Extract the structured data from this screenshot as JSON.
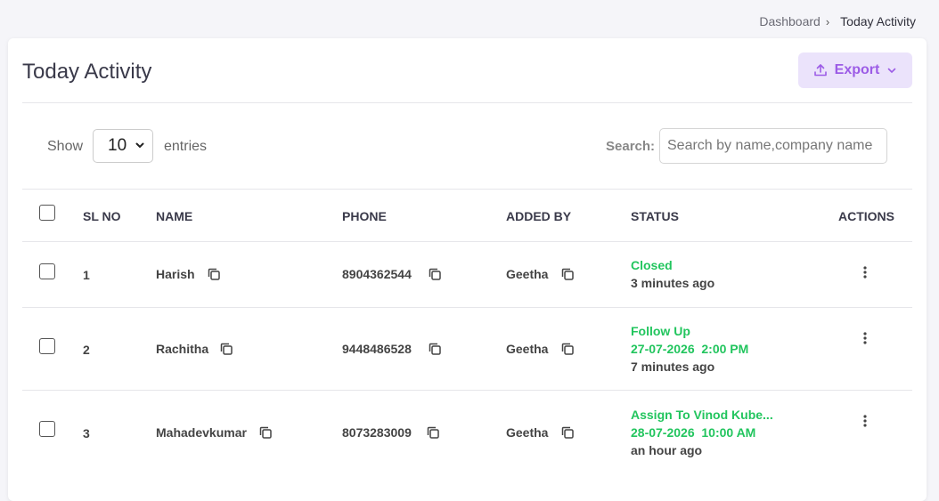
{
  "breadcrumb": {
    "parent": "Dashboard",
    "separator": "›",
    "current": "Today Activity"
  },
  "page": {
    "title": "Today Activity"
  },
  "export": {
    "label": "Export"
  },
  "controls": {
    "show_label": "Show",
    "entries_value": "10",
    "entries_label": "entries",
    "search_label": "Search:",
    "search_placeholder": "Search by name,company name"
  },
  "table": {
    "headers": {
      "sl_no": "SL NO",
      "name": "NAME",
      "phone": "PHONE",
      "added_by": "ADDED BY",
      "status": "STATUS",
      "actions": "ACTIONS"
    },
    "rows": [
      {
        "sl": "1",
        "name": "Harish",
        "phone": "8904362544",
        "added_by": "Geetha",
        "status": "Closed",
        "status_detail": "",
        "time": "3 minutes ago"
      },
      {
        "sl": "2",
        "name": "Rachitha",
        "phone": "9448486528",
        "added_by": "Geetha",
        "status": "Follow Up",
        "status_detail": "27-07-2026  2:00 PM",
        "time": "7 minutes ago"
      },
      {
        "sl": "3",
        "name": "Mahadevkumar",
        "phone": "8073283009",
        "added_by": "Geetha",
        "status": "Assign To Vinod Kube...",
        "status_detail": "28-07-2026  10:00 AM",
        "time": "an hour ago"
      }
    ]
  },
  "colors": {
    "accent": "#9c5ce6",
    "accent_bg": "#ebe3fb",
    "status_green": "#22c55e"
  }
}
